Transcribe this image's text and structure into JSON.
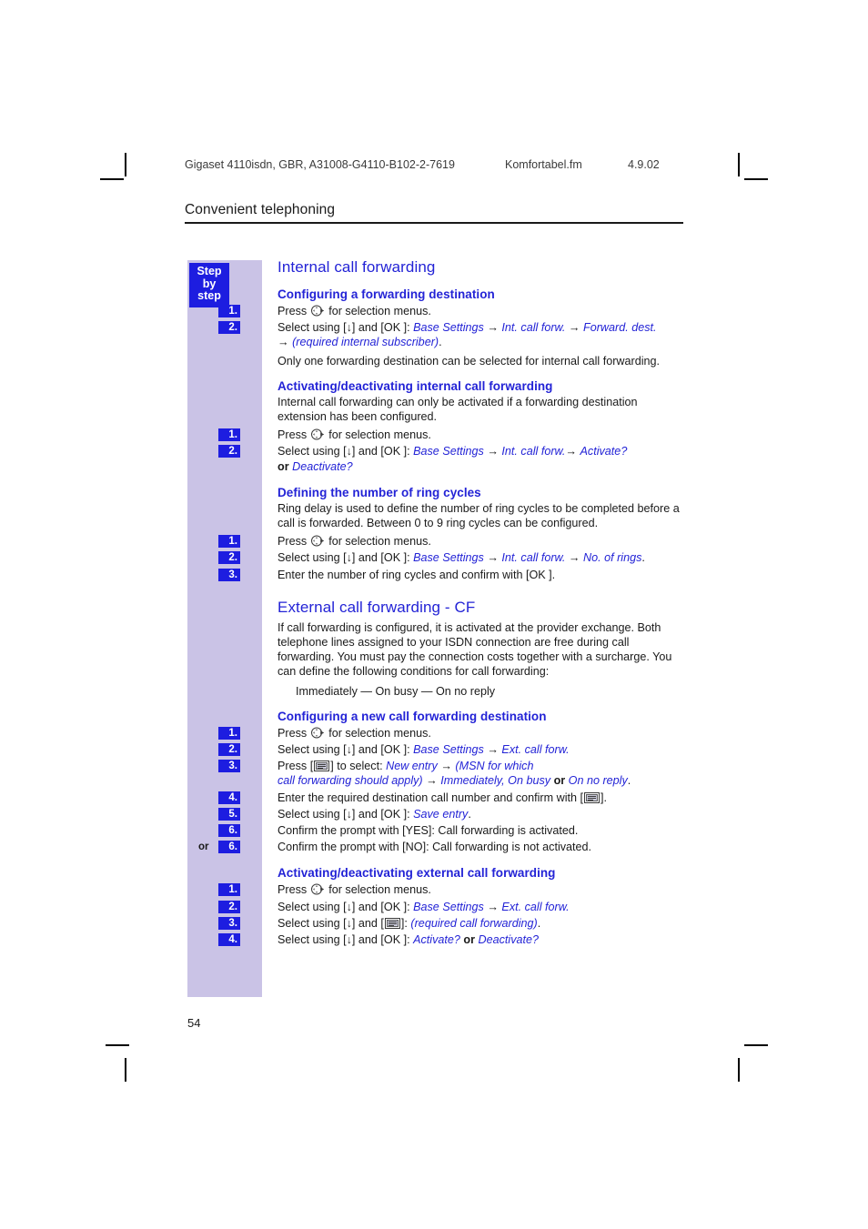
{
  "page": {
    "folio": "54",
    "running_head": {
      "doc_id": "Gigaset 4110isdn, GBR, A31008-G4110-B102-2-7619",
      "file_name": "Komfortabel.fm",
      "date": "4.9.02"
    },
    "chapter_title": "Convenient telephoning"
  },
  "sidebar": {
    "label_line1": "Step",
    "label_line2": "by",
    "label_line3": "step",
    "or_label": "or"
  },
  "colors": {
    "accent_blue": "#2323d6",
    "badge_blue": "#1d1de0",
    "sidebar_lavender": "#cac3e6",
    "body_text": "#1a1a1a"
  },
  "icons": {
    "nav_key": "navigation-key-icon",
    "display_key": "display-key-icon",
    "down_arrow": "[↓]",
    "ok_key": "[OK ]"
  },
  "sections": [
    {
      "id": "internal-call-forwarding",
      "heading": "Internal call forwarding",
      "subsections": [
        {
          "id": "configuring-forwarding-destination",
          "heading": "Configuring a forwarding destination",
          "intro": [],
          "steps": [
            {
              "num": "1.",
              "text_before": "Press ",
              "text_after": " for selection menus.",
              "icon": "nav_key"
            },
            {
              "num": "2.",
              "text": "Select using [↓] and [OK ]: Base Settings → Int. call forw. → Forward. dest. → (required internal subscriber)."
            }
          ],
          "outro": [
            "Only one forwarding destination can be selected for internal call forwarding."
          ]
        },
        {
          "id": "activating-deactivating-internal-call-forwarding",
          "heading": "Activating/deactivating internal call forwarding",
          "intro": [
            "Internal call forwarding can only be activated if a forwarding destination extension has been configured."
          ],
          "steps": [
            {
              "num": "1.",
              "text_before": "Press ",
              "text_after": " for selection menus.",
              "icon": "nav_key"
            },
            {
              "num": "2.",
              "text": "Select using [↓] and [OK ]: Base Settings → Int. call forw.→ Activate? or Deactivate?"
            }
          ],
          "outro": []
        },
        {
          "id": "defining-number-of-ring-cycles",
          "heading": "Defining the number of ring cycles",
          "intro": [
            "Ring delay is used to define the number of ring cycles to be completed before a call is forwarded. Between 0 to 9 ring cycles can be configured."
          ],
          "steps": [
            {
              "num": "1.",
              "text_before": "Press ",
              "text_after": " for selection menus.",
              "icon": "nav_key"
            },
            {
              "num": "2.",
              "text": "Select using [↓] and [OK ]: Base Settings → Int. call forw. → No. of rings."
            },
            {
              "num": "3.",
              "text": "Enter the number of ring cycles and confirm with [OK ]."
            }
          ],
          "outro": []
        }
      ]
    },
    {
      "id": "external-call-forwarding-cf",
      "heading": "External call forwarding - CF",
      "intro": [
        "If call forwarding is configured, it is activated at the provider exchange. Both telephone lines assigned to your ISDN connection are free during call forwarding. You must pay the connection costs together with a surcharge. You can define the following conditions for call forwarding:"
      ],
      "indented": "Immediately — On busy — On no reply",
      "subsections": [
        {
          "id": "configuring-new-call-forwarding-destination",
          "heading": "Configuring a new call forwarding destination",
          "intro": [],
          "steps": [
            {
              "num": "1.",
              "text_before": "Press ",
              "text_after": " for selection menus.",
              "icon": "nav_key"
            },
            {
              "num": "2.",
              "text": "Select using [↓] and [OK ]: Base Settings → Ext. call forw."
            },
            {
              "num": "3.",
              "text": "Press [▤] to select: New entry → (MSN for which call forwarding should apply) → Immediately, On busy or On no reply."
            },
            {
              "num": "4.",
              "text": "Enter the required destination call number and confirm with [▤]."
            },
            {
              "num": "5.",
              "text": "Select using [↓] and [OK ]: Save entry."
            },
            {
              "num": "6.",
              "text": "Confirm the prompt with [YES]: Call forwarding is activated."
            },
            {
              "num": "6.",
              "or": "or",
              "text": "Confirm the prompt with [NO]: Call forwarding is not activated."
            }
          ],
          "outro": []
        },
        {
          "id": "activating-deactivating-external-call-forwarding",
          "heading": "Activating/deactivating external call forwarding",
          "intro": [],
          "steps": [
            {
              "num": "1.",
              "text_before": "Press ",
              "text_after": " for selection menus.",
              "icon": "nav_key"
            },
            {
              "num": "2.",
              "text": "Select using [↓] and [OK ]: Base Settings → Ext. call forw."
            },
            {
              "num": "3.",
              "text": "Select using [↓] and [▤]: (required call forwarding)."
            },
            {
              "num": "4.",
              "text": "Select using [↓] and [OK ]: Activate? or Deactivate?"
            }
          ],
          "outro": []
        }
      ]
    }
  ]
}
